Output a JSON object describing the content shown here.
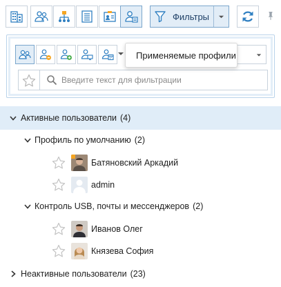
{
  "toolbar": {
    "filter_label": "Фильтры",
    "buttons": [
      "buildings-icon",
      "users-icon",
      "org-structure-icon",
      "list-icon",
      "id-card-icon",
      "profile-user-icon"
    ],
    "active_button": "profile-user-icon",
    "refresh_icon": "refresh-icon",
    "pin_icon": "pin-icon"
  },
  "filter_panel": {
    "profile_buttons": [
      "all-profiles-icon",
      "user-minus-icon",
      "user-plus-icon",
      "user-computer-icon",
      "user-calendar-icon"
    ],
    "combo_value": "",
    "search_placeholder": "Введите текст для фильтрации",
    "search_value": ""
  },
  "tooltip": {
    "text": "Применяемые профили"
  },
  "tree": {
    "active_group": {
      "label": "Активные пользователи",
      "count": "(4)",
      "expanded": true
    },
    "profiles": [
      {
        "label": "Профиль по умолчанию",
        "count": "(2)",
        "users": [
          {
            "name": "Батяновский Аркадий",
            "avatar": "male-photo",
            "badge_color": "#f5a623"
          },
          {
            "name": "admin",
            "avatar": "placeholder"
          }
        ]
      },
      {
        "label": "Контроль USB, почты и мессенджеров",
        "count": "(2)",
        "users": [
          {
            "name": "Иванов Олег",
            "avatar": "male-photo"
          },
          {
            "name": "Князева София",
            "avatar": "female-photo"
          }
        ]
      }
    ],
    "inactive_group": {
      "label": "Неактивные пользователи",
      "count": "(23)",
      "expanded": false
    }
  },
  "colors": {
    "accent": "#2f7fc1",
    "selected_row": "#e0edf8",
    "panel_border": "#b9d3ea"
  }
}
